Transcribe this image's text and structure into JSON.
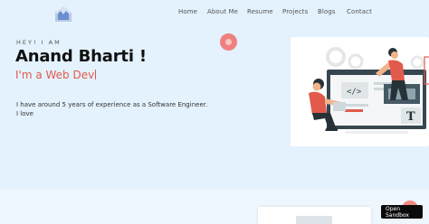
{
  "nav": {
    "items": [
      {
        "label": "Home"
      },
      {
        "label": "About Me"
      },
      {
        "label": "Resume"
      },
      {
        "label": "Projects"
      },
      {
        "label": "Blogs"
      },
      {
        "label": "Contact"
      }
    ]
  },
  "hero": {
    "greeting": "HEY! I AM",
    "name": "Anand Bharti !",
    "role": "I'm a Web Dev",
    "description_line1": "I have around 5 years of experience as a Software Engineer.",
    "description_line2": "I love"
  },
  "sandbox": {
    "label": "Open Sandbox"
  },
  "colors": {
    "background": "#e3f2fd",
    "accent": "#e15a4c",
    "logo": "#6b8fcf"
  },
  "icons": {
    "logo": "envelope-logo-icon",
    "illustration": "developer-coding-illustration"
  }
}
